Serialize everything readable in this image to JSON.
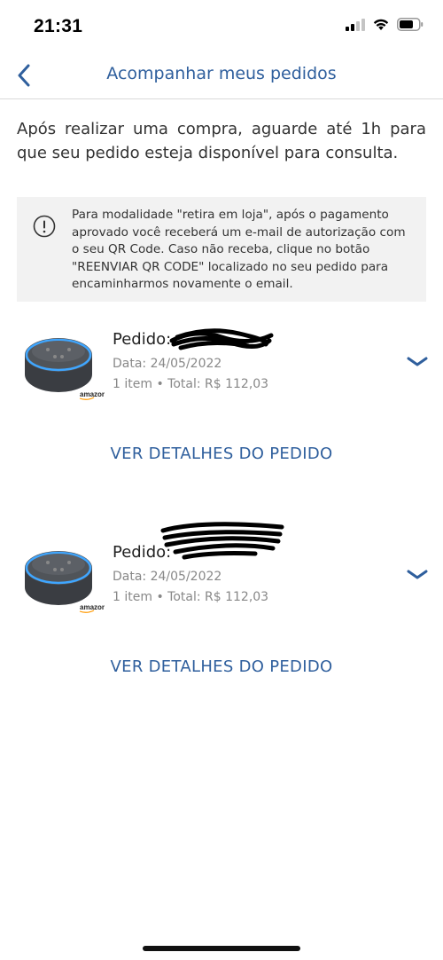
{
  "status_bar": {
    "time": "21:31"
  },
  "header": {
    "title": "Acompanhar meus pedidos"
  },
  "intro_text": "Após realizar uma compra, aguarde até 1h para que seu pedido esteja disponível para consulta.",
  "notice": {
    "text": "Para modalidade \"retira em loja\", após o pagamento aprovado você receberá um e-mail de autorização com o seu QR Code. Caso não receba, clique no botão \"REENVIAR QR CODE\" localizado no seu pedido para encaminharmos novamente o email."
  },
  "orders": [
    {
      "title": "Pedido:",
      "date": "Data: 24/05/2022",
      "total": "1 item • Total: R$ 112,03",
      "details_label": "VER DETALHES DO PEDIDO",
      "image_brand": "amazon"
    },
    {
      "title": "Pedido:",
      "date": "Data: 24/05/2022",
      "total": "1 item • Total: R$ 112,03",
      "details_label": "VER DETALHES DO PEDIDO",
      "image_brand": "amazon"
    }
  ],
  "colors": {
    "accent": "#2f5f9d",
    "notice_bg": "#f2f2f2"
  }
}
